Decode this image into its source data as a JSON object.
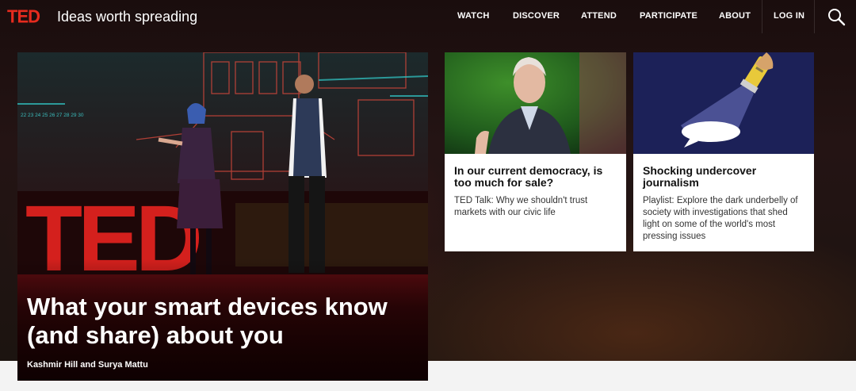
{
  "header": {
    "logo": "TED",
    "tagline": "Ideas worth spreading",
    "nav": [
      "WATCH",
      "DISCOVER",
      "ATTEND",
      "PARTICIPATE",
      "ABOUT",
      "LOG IN"
    ],
    "search_icon": "search-icon"
  },
  "feature": {
    "title": "What your smart devices know (and share) about you",
    "speakers": "Kashmir Hill and Surya Mattu",
    "stage_numbers": "22 23 24 25 26 27 28 29 30",
    "stage_letters": "TED"
  },
  "cards": [
    {
      "title": "In our current democracy, is too much for sale?",
      "description": "TED Talk: Why we shouldn't trust markets with our civic life"
    },
    {
      "title": "Shocking undercover journalism",
      "description": "Playlist: Explore the dark underbelly of society with investigations that shed light on some of the world's most pressing issues"
    }
  ],
  "colors": {
    "brand_red": "#e62b1e",
    "header_text": "#ffffff",
    "card_bg": "#ffffff",
    "playlist_bg": "#1c2158"
  }
}
